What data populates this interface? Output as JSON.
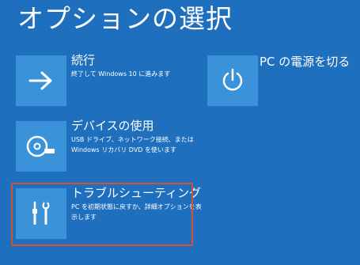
{
  "page": {
    "title": "オプションの選択"
  },
  "options": {
    "continue": {
      "title": "続行",
      "desc": "終了して Windows 10 に進みます",
      "icon": "arrow-right-icon"
    },
    "device": {
      "title": "デバイスの使用",
      "desc": "USB ドライブ、ネットワーク接続、または Windows リカバリ DVD を使います",
      "icon": "disc-drive-icon"
    },
    "troubleshoot": {
      "title": "トラブルシューティング",
      "desc": "PC を初期状態に戻すか、詳細オプションを表示します",
      "icon": "tools-icon"
    },
    "power": {
      "title": "PC の電源を切る",
      "icon": "power-icon"
    }
  },
  "colors": {
    "background": "#1f6fbf",
    "tile": "#3a92d9",
    "highlight": "#d2522e",
    "text": "#ffffff"
  }
}
